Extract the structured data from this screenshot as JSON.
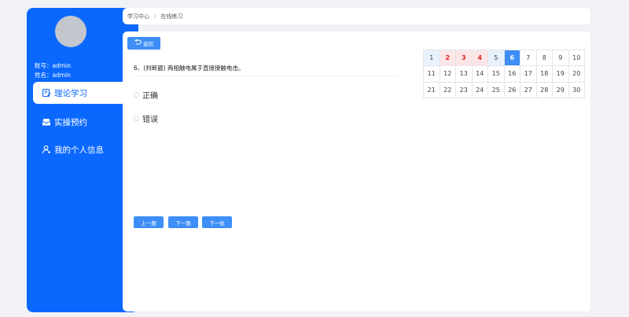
{
  "sidebar": {
    "account_label": "账号：admin",
    "name_label": "姓名：admin",
    "items": [
      {
        "label": "理论学习",
        "icon": "edit-icon"
      },
      {
        "label": "实操预约",
        "icon": "inbox-icon"
      },
      {
        "label": "我的个人信息",
        "icon": "user-icon"
      }
    ]
  },
  "breadcrumb": {
    "items": [
      "学习中心",
      "在线练习"
    ],
    "separator": "/"
  },
  "main": {
    "back_label": "返回",
    "question": "6、(判断题) 两相触电属于直接接触电击。",
    "options": [
      "正确",
      "错误"
    ],
    "buttons": {
      "prev": "上一题",
      "next": "下一题",
      "batch": "下一批"
    }
  },
  "answer_grid": {
    "cells": [
      {
        "num": "1",
        "state": "visited"
      },
      {
        "num": "2",
        "state": "wrong"
      },
      {
        "num": "3",
        "state": "wrong"
      },
      {
        "num": "4",
        "state": "wrong"
      },
      {
        "num": "5",
        "state": "visited"
      },
      {
        "num": "6",
        "state": "current"
      },
      {
        "num": "7",
        "state": "none"
      },
      {
        "num": "8",
        "state": "none"
      },
      {
        "num": "9",
        "state": "none"
      },
      {
        "num": "10",
        "state": "none"
      },
      {
        "num": "11",
        "state": "none"
      },
      {
        "num": "12",
        "state": "none"
      },
      {
        "num": "13",
        "state": "none"
      },
      {
        "num": "14",
        "state": "none"
      },
      {
        "num": "15",
        "state": "none"
      },
      {
        "num": "16",
        "state": "none"
      },
      {
        "num": "17",
        "state": "none"
      },
      {
        "num": "18",
        "state": "none"
      },
      {
        "num": "19",
        "state": "none"
      },
      {
        "num": "20",
        "state": "none"
      },
      {
        "num": "21",
        "state": "none"
      },
      {
        "num": "22",
        "state": "none"
      },
      {
        "num": "23",
        "state": "none"
      },
      {
        "num": "24",
        "state": "none"
      },
      {
        "num": "25",
        "state": "none"
      },
      {
        "num": "26",
        "state": "none"
      },
      {
        "num": "27",
        "state": "none"
      },
      {
        "num": "28",
        "state": "none"
      },
      {
        "num": "29",
        "state": "none"
      },
      {
        "num": "30",
        "state": "none"
      }
    ]
  },
  "colors": {
    "sidebar": "#0a68ff",
    "primary_button": "#3d8ef7",
    "wrong": "#e02020",
    "wrong_bg": "#fde6e6",
    "visited_bg": "#e8f2fd"
  }
}
